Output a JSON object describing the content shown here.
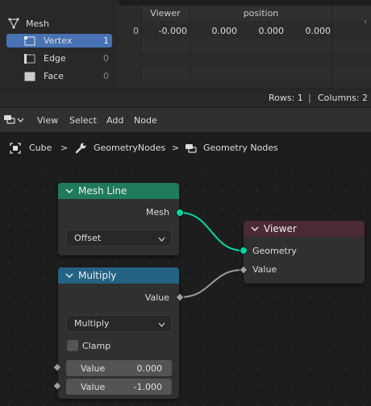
{
  "spreadsheet": {
    "domain_root": "Mesh",
    "domains": [
      {
        "label": "Vertex",
        "count": "1",
        "selected": true,
        "icon": "vertex-icon"
      },
      {
        "label": "Edge",
        "count": "0",
        "selected": false,
        "icon": "edge-icon"
      },
      {
        "label": "Face",
        "count": "0",
        "selected": false,
        "icon": "face-icon"
      }
    ],
    "columns": [
      "Viewer",
      "position"
    ],
    "row_index": "0",
    "row_values": [
      "-0.000",
      "0.000",
      "0.000",
      "0.000"
    ],
    "status_rows": "Rows: 1",
    "status_sep": "|",
    "status_columns": "Columns: 2"
  },
  "header": {
    "menus": [
      "View",
      "Select",
      "Add",
      "Node"
    ]
  },
  "breadcrumb": {
    "object": "Cube",
    "modifier": "GeometryNodes",
    "tree": "Geometry Nodes",
    "sep": ">"
  },
  "nodes": {
    "mesh_line": {
      "title": "Mesh Line",
      "output": "Mesh",
      "mode": "Offset",
      "color": "#1f7a5e"
    },
    "multiply": {
      "title": "Multiply",
      "output": "Value",
      "operation": "Multiply",
      "clamp_label": "Clamp",
      "clamp_checked": false,
      "inputs": [
        {
          "label": "Value",
          "value": "0.000"
        },
        {
          "label": "Value",
          "value": "-1.000"
        }
      ],
      "color": "#246283"
    },
    "viewer": {
      "title": "Viewer",
      "inputs": [
        "Geometry",
        "Value"
      ],
      "color": "#4a2a33"
    }
  }
}
